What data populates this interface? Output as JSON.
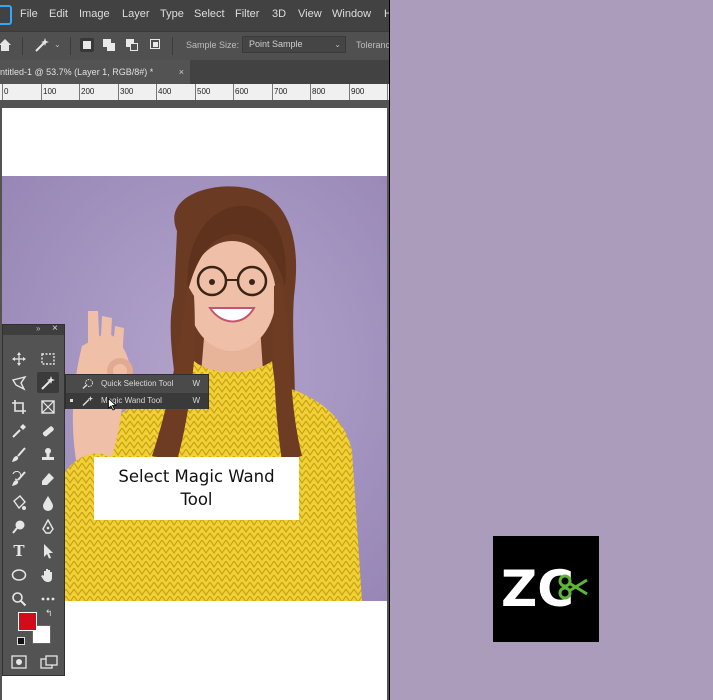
{
  "menu": {
    "items": [
      "File",
      "Edit",
      "Image",
      "Layer",
      "Type",
      "Select",
      "Filter",
      "3D",
      "View",
      "Window",
      "H"
    ]
  },
  "options_bar": {
    "sample_size_label": "Sample Size:",
    "sample_size_value": "Point Sample",
    "tolerance_label": "Toleranc"
  },
  "document": {
    "tab_title": "ntitled-1 @ 53.7% (Layer 1, RGB/8#) *",
    "close_glyph": "×"
  },
  "ruler": {
    "labels": [
      "0",
      "100",
      "200",
      "300",
      "400",
      "500",
      "600",
      "700",
      "800",
      "900"
    ]
  },
  "tools_flyout": {
    "items": [
      {
        "label": "Quick Selection Tool",
        "shortcut": "W",
        "selected": false
      },
      {
        "label": "Magic Wand Tool",
        "shortcut": "W",
        "selected": true
      }
    ]
  },
  "tool_icons": [
    "move-icon",
    "marquee-icon",
    "lasso-icon",
    "magic-wand-icon",
    "crop-icon",
    "frame-icon",
    "eyedropper-icon",
    "healing-brush-icon",
    "brush-icon",
    "stamp-icon",
    "history-brush-icon",
    "eraser-icon",
    "gradient-icon",
    "blur-icon",
    "dodge-icon",
    "pen-icon",
    "type-icon",
    "path-select-icon",
    "ellipse-icon",
    "hand-icon",
    "zoom-icon",
    "more-icon"
  ],
  "colors": {
    "foreground": "#d10d1b",
    "background": "#ffffff",
    "photo_backdrop": "#a696c2",
    "panel_right": "#ab9cbb",
    "logo_accent": "#5fb43a"
  },
  "caption": {
    "line1": "Select Magic Wand",
    "line2": "Tool"
  },
  "logo": {
    "letters": "ZC"
  }
}
